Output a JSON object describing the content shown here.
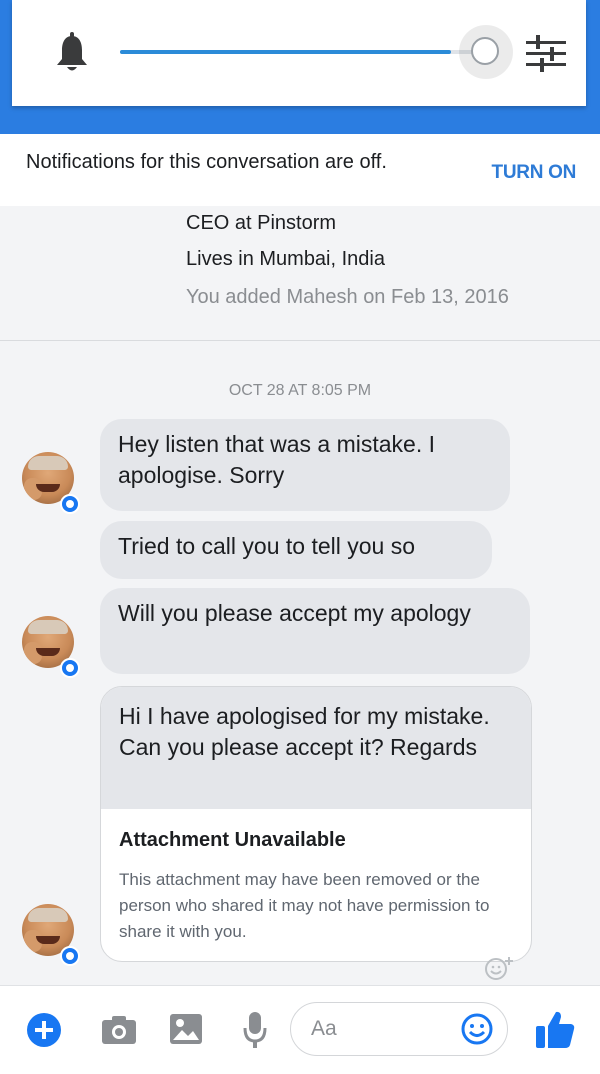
{
  "volume": {
    "level": 0.92,
    "accent": "#2b8bd8",
    "icons": [
      "bell-icon",
      "sliders-icon"
    ]
  },
  "notification": {
    "text": "Notifications for this conversation are off.",
    "button": "TURN ON"
  },
  "profile": {
    "job": "CEO at Pinstorm",
    "location": "Lives in Mumbai, India",
    "added": "You added Mahesh on Feb 13, 2016"
  },
  "conversation": {
    "timestamp": "OCT 28 AT 8:05 PM",
    "messages": [
      {
        "text": "Hey listen that was a mistake. I apologise. Sorry"
      },
      {
        "text": "Tried to call you to tell you so"
      },
      {
        "text": "Will you please accept my apology"
      },
      {
        "text": "Hi I have apologised for my mistake. Can you please accept it? Regards"
      }
    ],
    "attachment": {
      "title": "Attachment Unavailable",
      "body": "This attachment may have been removed or the person who shared it may not have permission to share it with you."
    }
  },
  "composer": {
    "placeholder": "Aa",
    "accent": "#1877f2",
    "icons": [
      "plus-icon",
      "camera-icon",
      "gallery-icon",
      "microphone-icon",
      "emoji-icon",
      "like-icon"
    ]
  }
}
